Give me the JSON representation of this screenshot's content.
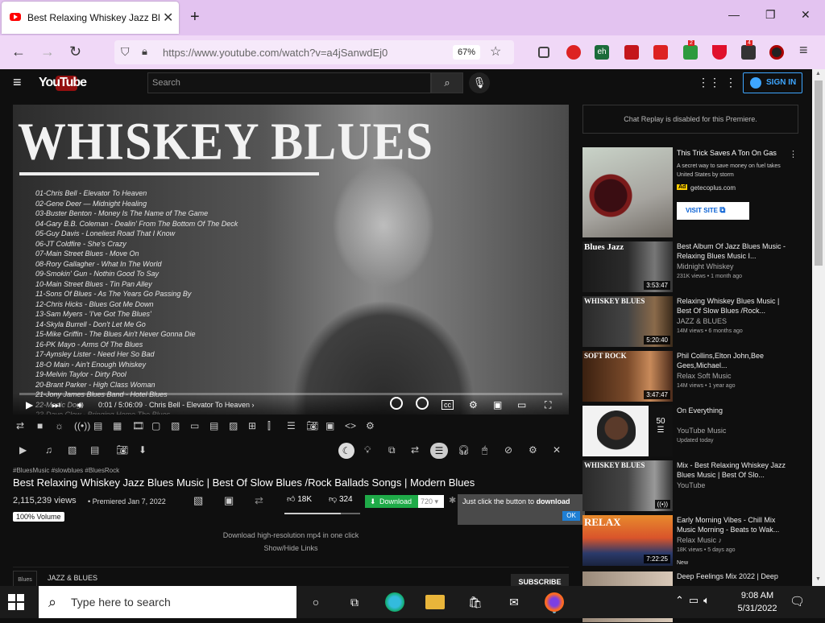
{
  "browser": {
    "tab_title": "Best Relaxing Whiskey Jazz Blues",
    "tab_close": "✕",
    "new_tab": "+",
    "url": "https://www.youtube.com/watch?v=a4jSanwdEj0",
    "zoom": "67%",
    "win_min": "—",
    "win_max": "❐",
    "win_close": "✕",
    "ext_badges": [
      "2",
      "4"
    ]
  },
  "youtube": {
    "logo": "YouTube",
    "search_placeholder": "Search",
    "sign_in": "SIGN IN"
  },
  "player": {
    "poster_title": "WHISKEY BLUES",
    "tracks": [
      "01-Chris Bell - Elevator To Heaven",
      "02-Gene Deer — Midnight Healing",
      "03-Buster Benton - Money Is The Name of The Game",
      "04-Gary B.B. Coleman - Dealin' From The Bottom Of The Deck",
      "05-Guy Davis - Loneliest Road That I Know",
      "06-JT Coldfire - She's Crazy",
      "07-Main Street Blues - Move On",
      "08-Rory Gallagher - What In The World",
      "09-Smokin' Gun - Nothin Good To Say",
      "10-Main Street Blues - Tin Pan Alley",
      "11-Sons Of Blues - As The Years Go Passing By",
      "12-Chris Hicks - Blues Got Me Down",
      "13-Sam Myers - 'I've Got The Blues'",
      "14-Skyla Burrell - Don't Let Me Go",
      "15-Mike Griffin - The Blues Ain't Never Gonna Die",
      "16-PK Mayo - Arms Of The Blues",
      "17-Aynsley Lister - Need Her So Bad",
      "18-O Main - Ain't Enough Whiskey",
      "19-Melvin Taylor - Dirty Pool",
      "20-Brant Parker - High Class Woman",
      "21-Jony James Blues Band - Hotel Blues",
      "22-Manic Dog",
      "23-Dave Clow - Bringing Home The Blues"
    ],
    "time": "0:01 / 5:06:09",
    "chapter": "· Chris Bell - Elevator To Heaven ›"
  },
  "video": {
    "tags": "#BluesMusic #slowblues #BluesRock",
    "title": "Best Relaxing Whiskey Jazz Blues Music | Best Of Slow Blues /Rock Ballads Songs | Modern Blues",
    "views": "2,115,239 views",
    "premiered": "• Premiered Jan 7, 2022",
    "volume": "100% Volume",
    "likes": "18K",
    "dislikes": "324",
    "download_label": "Download",
    "quality": "720",
    "popup_text": "Just click the button to",
    "popup_bold": "download",
    "popup_ok": "OK",
    "hint": "Download high-resolution mp4 in one click",
    "show_hide": "Show/Hide Links",
    "channel": "JAZZ & BLUES",
    "channel_logo": "Blues",
    "subscribe": "SUBSCRIBE"
  },
  "sidebar": {
    "chat": "Chat Replay is disabled for this Premiere.",
    "ad": {
      "title": "This Trick Saves A Ton On Gas",
      "desc": "A secret way to save money on fuel takes United States by storm",
      "badge": "Ad",
      "domain": "getecoplus.com",
      "visit": "VISIT SITE"
    },
    "items": [
      {
        "title": "Best Album Of Jazz Blues Music - Relaxing Blues Music I...",
        "channel": "Midnight Whiskey",
        "meta": "231K views • 1 month ago",
        "duration": "3:53:47",
        "thumb": "Blues Jazz"
      },
      {
        "title": "Relaxing Whiskey Blues Music | Best Of Slow Blues /Rock...",
        "channel": "JAZZ & BLUES",
        "meta": "14M views • 6 months ago",
        "duration": "5:20:40",
        "thumb": "WHISKEY BLUES"
      },
      {
        "title": "Phil Collins,Elton John,Bee Gees,Michael...",
        "channel": "Relax Soft Music",
        "meta": "14M views • 1 year ago",
        "duration": "3:47:47",
        "thumb": "SOFT ROCK"
      },
      {
        "title": "On Everything",
        "channel": "YouTube Music",
        "meta": "Updated today",
        "duration": "50",
        "thumb": ""
      },
      {
        "title": "Mix - Best Relaxing Whiskey Jazz Blues Music | Best Of Slo...",
        "channel": "YouTube",
        "meta": "",
        "duration": "((•))",
        "thumb": "WHISKEY BLUES"
      },
      {
        "title": "Early Morning Vibes - Chill Mix Music Morning - Beats to Wak...",
        "channel": "Relax Music ♪",
        "meta": "18K views • 5 days ago",
        "duration": "7:22:25",
        "thumb": "RELAX",
        "badge": "New"
      },
      {
        "title": "Deep Feelings Mix 2022 | Deep",
        "channel": "",
        "meta": "",
        "duration": "",
        "thumb": ""
      }
    ]
  },
  "taskbar": {
    "search": "Type here to search",
    "time": "9:08 AM",
    "date": "5/31/2022"
  }
}
